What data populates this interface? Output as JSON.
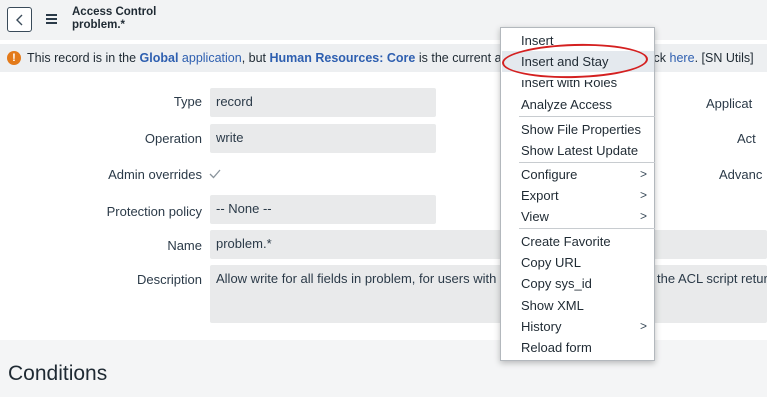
{
  "header": {
    "title_line1": "Access Control",
    "title_line2": "problem.*"
  },
  "banner": {
    "t1": "This record is in the ",
    "global": "Global",
    "t2": " application",
    "t3": ", but ",
    "scope": "Human Resources: Core",
    "t4": " is the current app",
    "right_t1": "lick ",
    "right_here": "here",
    "right_t2": ".  [SN Utils]"
  },
  "form": {
    "type_label": "Type",
    "type_value": "record",
    "operation_label": "Operation",
    "operation_value": "write",
    "admin_label": "Admin overrides",
    "protection_label": "Protection policy",
    "protection_value": "-- None --",
    "name_label": "Name",
    "name_value": "problem.*",
    "description_label": "Description",
    "description_left": "Allow write for all fields in problem, for users with r",
    "description_right": "the ACL script retur",
    "right_labels": {
      "application": "Applicat",
      "active": "Act",
      "advanced": "Advanc"
    }
  },
  "section": {
    "conditions_title": "Conditions"
  },
  "context_menu": {
    "items": [
      {
        "label": "Insert"
      },
      {
        "label": "Insert and Stay",
        "highlighted": true
      },
      {
        "label": "Insert with Roles"
      },
      {
        "label": "Analyze Access"
      },
      {
        "label": "Show File Properties"
      },
      {
        "label": "Show Latest Update"
      },
      {
        "label": "Configure",
        "submenu": true
      },
      {
        "label": "Export",
        "submenu": true
      },
      {
        "label": "View",
        "submenu": true
      },
      {
        "label": "Create Favorite"
      },
      {
        "label": "Copy URL"
      },
      {
        "label": "Copy sys_id"
      },
      {
        "label": "Show XML"
      },
      {
        "label": "History",
        "submenu": true
      },
      {
        "label": "Reload form"
      }
    ],
    "submenu_glyph": ">"
  },
  "colors": {
    "accent_link": "#2e5fb0",
    "warning": "#e37a1a",
    "annotation_red": "#d42020"
  }
}
